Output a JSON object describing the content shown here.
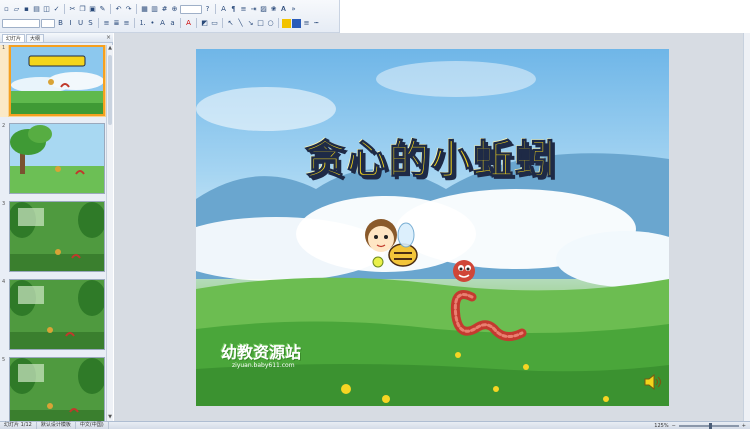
{
  "toolbar": {
    "row1": [
      "new",
      "open",
      "save",
      "print",
      "preview",
      "spell",
      "cut",
      "copy",
      "paste",
      "format-painter",
      "undo",
      "redo",
      "insert-table",
      "insert-chart",
      "grid",
      "zoom",
      "help",
      "sep",
      "text",
      "para",
      "bullets",
      "indent"
    ],
    "row2": [
      "bold",
      "italic",
      "underline",
      "shadow",
      "strike",
      "sep",
      "align-left",
      "center",
      "align-right",
      "justify",
      "sep",
      "bullets",
      "numbers",
      "sep",
      "font-color",
      "sep",
      "design",
      "new-slide",
      "sep",
      "shapes",
      "line",
      "arrow",
      "rect",
      "ellipse",
      "sep",
      "fill-color",
      "line-color"
    ]
  },
  "left_pane": {
    "tabs": [
      "幻灯片",
      "大纲"
    ],
    "close_glyph": "×",
    "slides": [
      {
        "number": "1",
        "selected": true
      },
      {
        "number": "2",
        "selected": false
      },
      {
        "number": "3",
        "selected": false
      },
      {
        "number": "4",
        "selected": false
      },
      {
        "number": "5",
        "selected": false
      }
    ]
  },
  "slide": {
    "title": "贪心的小蚯蚓",
    "watermark": "幼教资源站",
    "watermark_url": "ziyuan.baby611.com"
  },
  "status_bar": {
    "slide_counter": "幻灯片 1/12",
    "theme": "默认设计模板",
    "language": "中文(中国)",
    "zoom": "125%"
  },
  "colors": {
    "title_fill": "#f4d51b",
    "title_outline": "#1e2a46",
    "selected_thumb": "#f5a020",
    "sky": "#6fb6e8",
    "grass": "#3f9a35"
  }
}
